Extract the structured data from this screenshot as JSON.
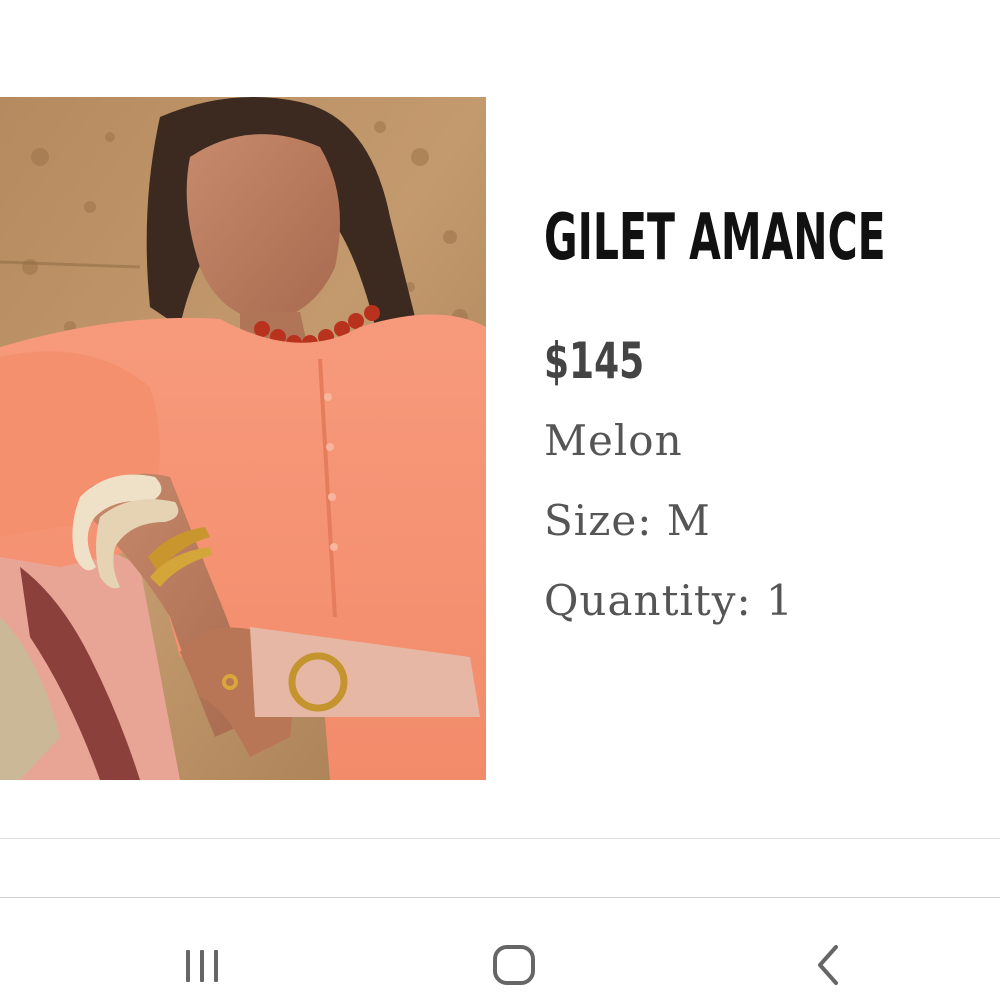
{
  "product": {
    "image_alt": "Model wearing melon cardigan",
    "name": "GILET AMANCE",
    "price": "$145",
    "color": "Melon",
    "size": "Size: M",
    "quantity": "Quantity: 1"
  },
  "navigation": {
    "recents_icon": "recents-icon",
    "home_icon": "home-icon",
    "back_icon": "back-icon"
  },
  "colors": {
    "background": "#ffffff",
    "title": "#111111",
    "price": "#444444",
    "details": "#555555",
    "nav_icons": "#666666"
  }
}
